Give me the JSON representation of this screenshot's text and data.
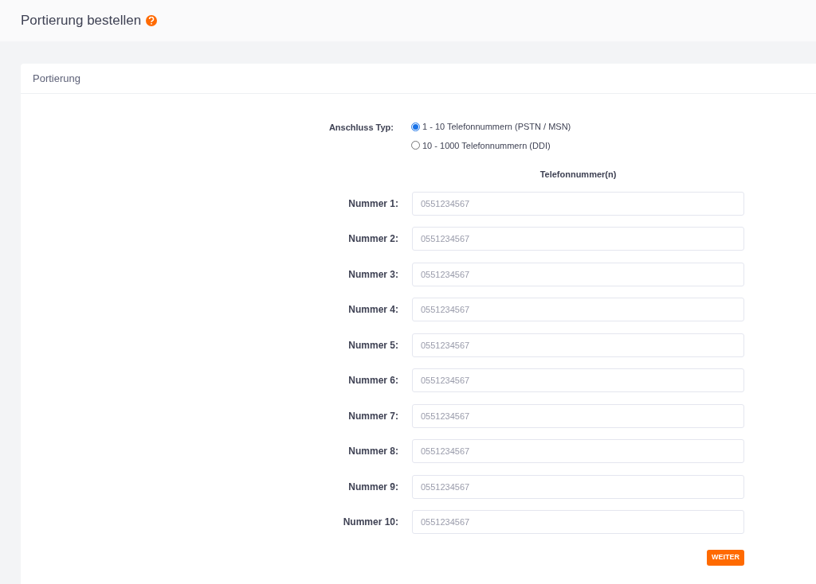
{
  "page": {
    "title": "Portierung bestellen"
  },
  "card": {
    "title": "Portierung"
  },
  "connection_type": {
    "label": "Anschluss Typ:",
    "options": [
      {
        "label": "1 - 10 Telefonnummern (PSTN / MSN)",
        "selected": true
      },
      {
        "label": "10 - 1000 Telefonnummern (DDI)",
        "selected": false
      }
    ]
  },
  "numbers_heading": "Telefonnummer(n)",
  "numbers": [
    {
      "label": "Nummer 1:",
      "placeholder": "0551234567"
    },
    {
      "label": "Nummer 2:",
      "placeholder": "0551234567"
    },
    {
      "label": "Nummer 3:",
      "placeholder": "0551234567"
    },
    {
      "label": "Nummer 4:",
      "placeholder": "0551234567"
    },
    {
      "label": "Nummer 5:",
      "placeholder": "0551234567"
    },
    {
      "label": "Nummer 6:",
      "placeholder": "0551234567"
    },
    {
      "label": "Nummer 7:",
      "placeholder": "0551234567"
    },
    {
      "label": "Nummer 8:",
      "placeholder": "0551234567"
    },
    {
      "label": "Nummer 9:",
      "placeholder": "0551234567"
    },
    {
      "label": "Nummer 10:",
      "placeholder": "0551234567"
    }
  ],
  "submit": "WEITER"
}
